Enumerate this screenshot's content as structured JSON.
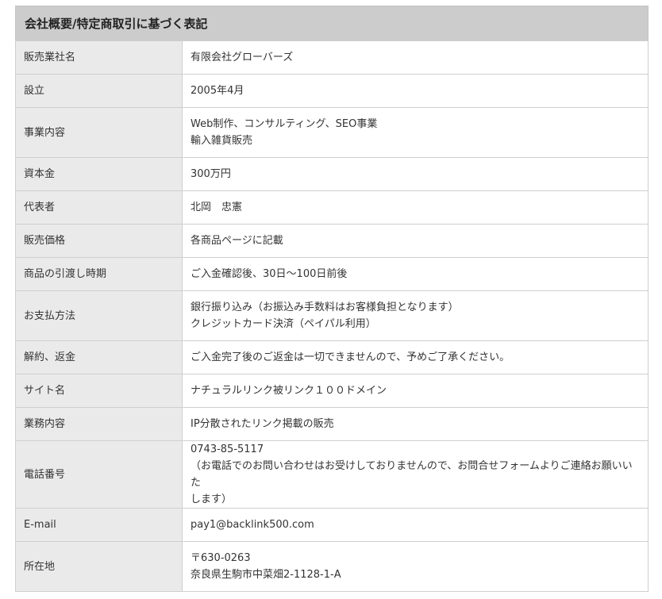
{
  "title": "会社概要/特定商取引に基づく表記",
  "rows": [
    {
      "label": "販売業社名",
      "lines": [
        "有限会社グローバーズ"
      ]
    },
    {
      "label": "設立",
      "lines": [
        "2005年4月"
      ]
    },
    {
      "label": "事業内容",
      "lines": [
        "Web制作、コンサルティング、SEO事業",
        "輸入雑貨販売"
      ]
    },
    {
      "label": "資本金",
      "lines": [
        "300万円"
      ]
    },
    {
      "label": "代表者",
      "lines": [
        "北岡　忠憲"
      ]
    },
    {
      "label": "販売価格",
      "lines": [
        "各商品ページに記載"
      ]
    },
    {
      "label": "商品の引渡し時期",
      "lines": [
        "ご入金確認後、30日～100日前後"
      ]
    },
    {
      "label": "お支払方法",
      "lines": [
        "銀行振り込み（お振込み手数料はお客様負担となります）",
        "クレジットカード決済（ペイパル利用）"
      ]
    },
    {
      "label": "解約、返金",
      "lines": [
        "ご入金完了後のご返金は一切できませんので、予めご了承ください。"
      ]
    },
    {
      "label": "サイト名",
      "lines": [
        "ナチュラルリンク被リンク１００ドメイン"
      ]
    },
    {
      "label": "業務内容",
      "lines": [
        "IP分散されたリンク掲載の販売"
      ]
    },
    {
      "label": "電話番号",
      "lines": [
        "0743-85-5117",
        "（お電話でのお問い合わせはお受けしておりませんので、お問合せフォームよりご連絡お願いいた",
        "します）"
      ]
    },
    {
      "label": "E-mail",
      "lines": [
        "pay1@backlink500.com"
      ]
    },
    {
      "label": "所在地",
      "lines": [
        "〒630-0263",
        "奈良県生駒市中菜畑2-1128-1-A"
      ]
    }
  ]
}
